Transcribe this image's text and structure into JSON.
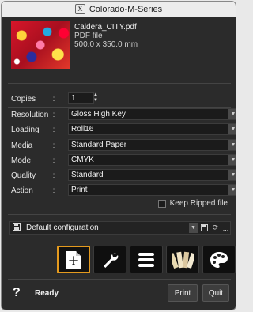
{
  "window": {
    "title": "Colorado-M-Series",
    "app_icon_glyph": "X"
  },
  "file": {
    "name": "Caldera_CITY.pdf",
    "type": "PDF file",
    "size": "500.0 x 350.0 mm"
  },
  "settings": {
    "copies": {
      "label": "Copies",
      "value": "1"
    },
    "resolution": {
      "label": "Resolution",
      "value": "Gloss High Key"
    },
    "loading": {
      "label": "Loading",
      "value": "Roll16"
    },
    "media": {
      "label": "Media",
      "value": "Standard Paper"
    },
    "mode": {
      "label": "Mode",
      "value": "CMYK"
    },
    "quality": {
      "label": "Quality",
      "value": "Standard"
    },
    "action": {
      "label": "Action",
      "value": "Print"
    },
    "colon": ":"
  },
  "keep_ripped": {
    "label": "Keep Ripped file",
    "checked": false
  },
  "configuration": {
    "value": "Default configuration",
    "more": "..."
  },
  "toolbar": {
    "tools": [
      "layout-icon",
      "wrench-icon",
      "list-icon",
      "swatch-icon",
      "palette-icon"
    ],
    "active_color": "#e49a1e"
  },
  "footer": {
    "help": "?",
    "status": "Ready",
    "print_label": "Print",
    "quit_label": "Quit"
  }
}
